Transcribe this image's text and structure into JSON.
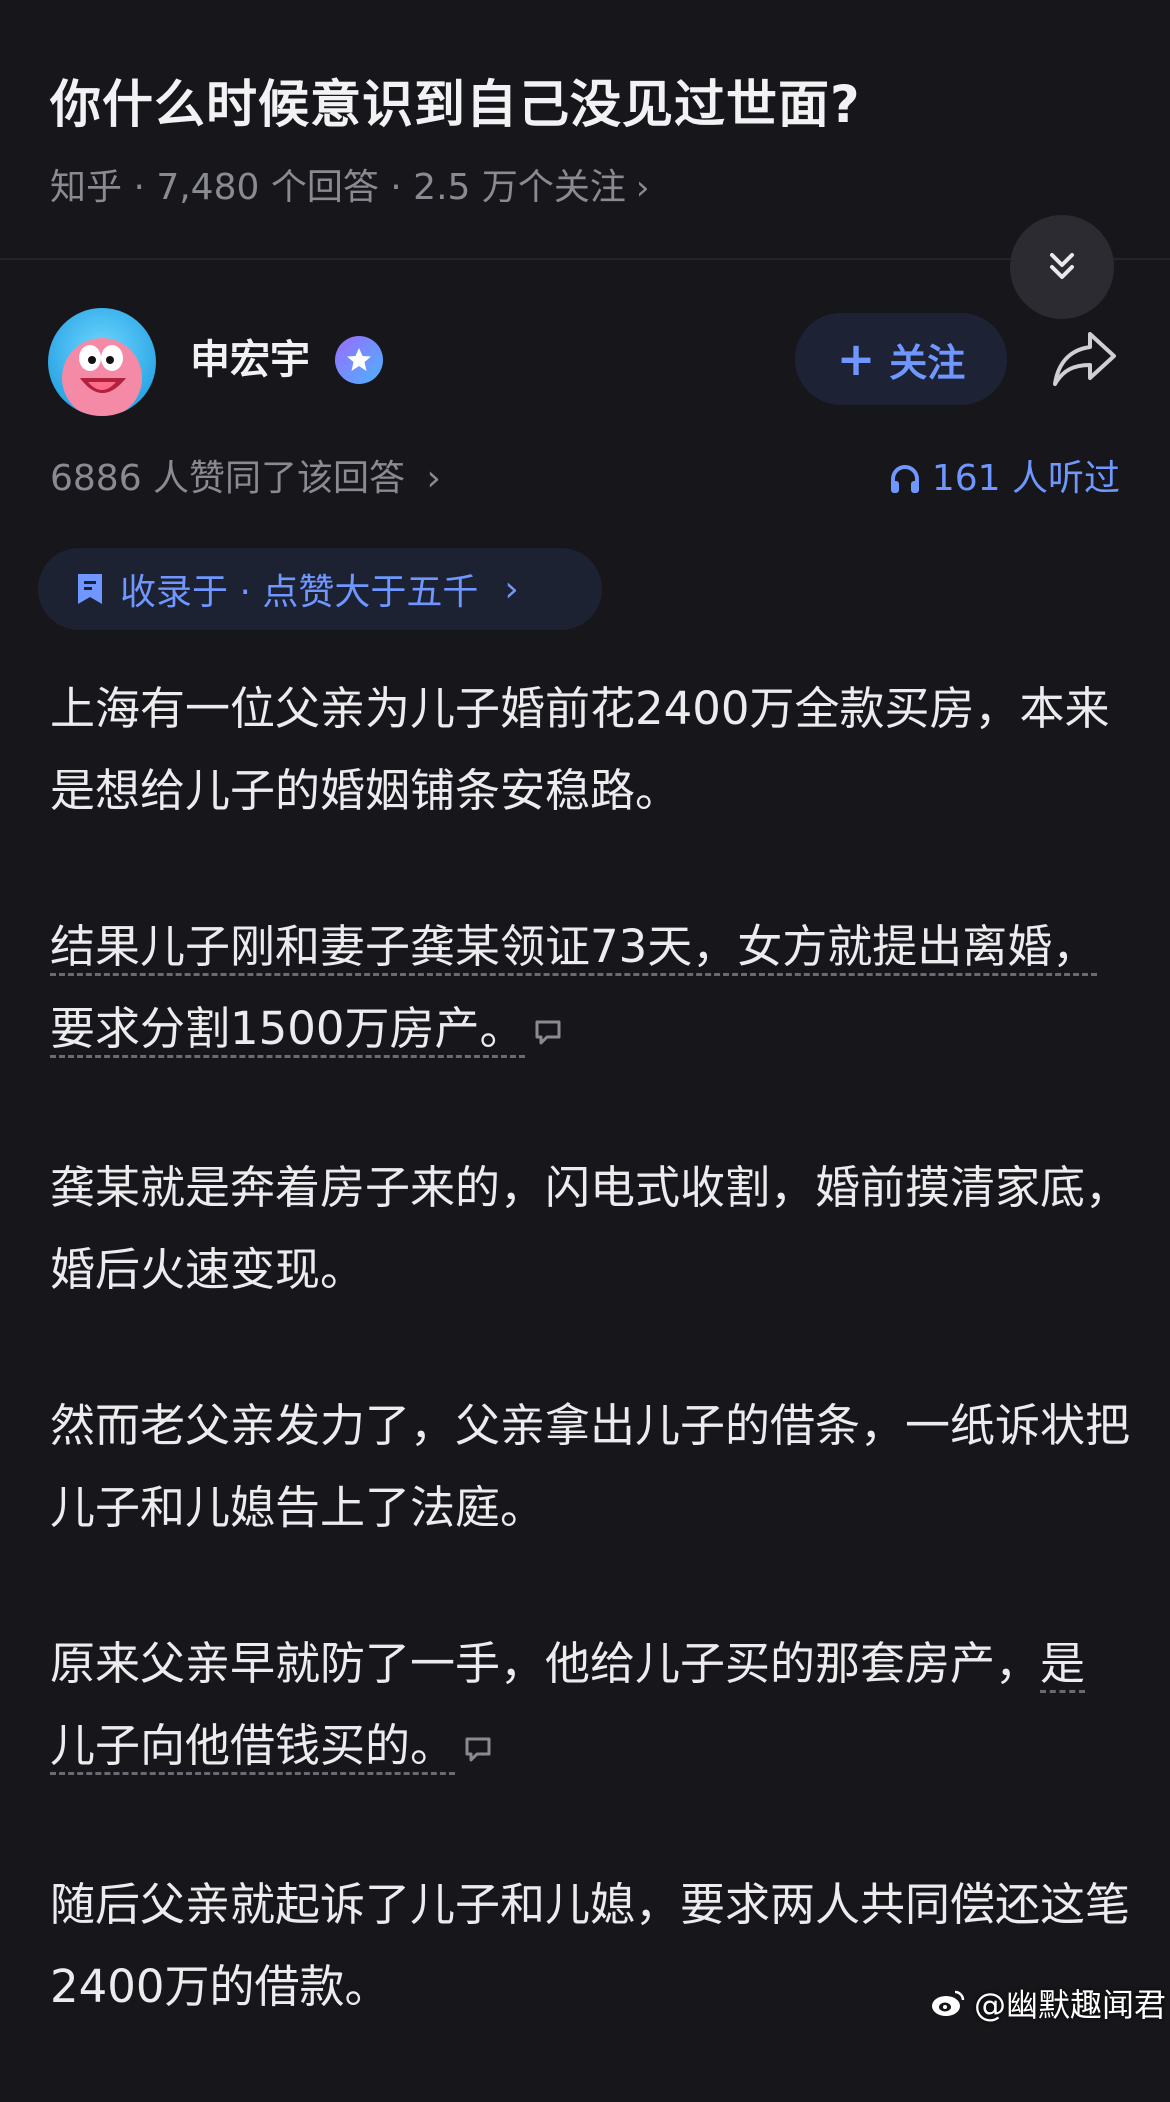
{
  "question": {
    "title": "你什么时候意识到自己没见过世面?",
    "meta": "知乎 · 7,480 个回答 · 2.5 万个关注",
    "meta_chevron": "›"
  },
  "author": {
    "name": "申宏宇",
    "follow_label": "关注",
    "follow_icon": "+"
  },
  "stats": {
    "likes": "6886 人赞同了该回答",
    "likes_chevron": "›",
    "listened": "161 人听过"
  },
  "collection": {
    "label": "收录于 · 点赞大于五千",
    "chevron": "›"
  },
  "paragraphs": [
    {
      "text": "上海有一位父亲为儿子婚前花2400万全款买房，本来是想给儿子的婚姻铺条安稳路。",
      "highlight": false
    },
    {
      "text": "结果儿子刚和妻子龚某领证73天，女方就提出离婚，要求分割1500万房产。",
      "highlight": true
    },
    {
      "text": "龚某就是奔着房子来的，闪电式收割，婚前摸清家底，婚后火速变现。",
      "highlight": false
    },
    {
      "text": "然而老父亲发力了，父亲拿出儿子的借条，一纸诉状把儿子和儿媳告上了法庭。",
      "highlight": false
    },
    {
      "text_plain": "原来父亲早就防了一手，他给儿子买的那套房产，",
      "text_hl": "是儿子向他借钱买的。",
      "highlight": "partial"
    },
    {
      "text": "随后父亲就起诉了儿子和儿媳，要求两人共同偿还这笔2400万的借款。",
      "highlight": false
    }
  ],
  "watermark": "@幽默趣闻君",
  "icons": {
    "collapse": "double-chevron-down-icon",
    "share": "share-arrow-icon",
    "headphones": "headphones-icon",
    "bookmark": "bookmark-icon",
    "comment": "comment-icon",
    "weibo": "weibo-icon"
  },
  "colors": {
    "background": "#17171b",
    "accent": "#6f97ff",
    "muted": "#8a8a92"
  }
}
